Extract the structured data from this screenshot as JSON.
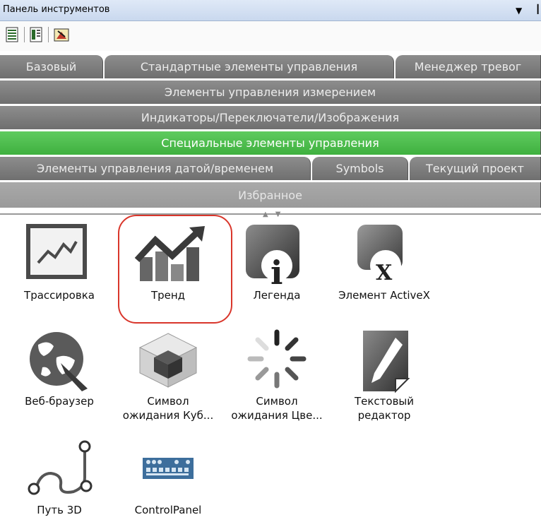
{
  "panel": {
    "title": "Панель инструментов",
    "pin_icon": "dropdown-arrow-icon",
    "extra_icon": "pin-icon"
  },
  "toolbar": {
    "icons": [
      "list-view-icon",
      "detail-view-icon",
      "picture-tool-icon"
    ]
  },
  "tabs": {
    "row1": [
      "Базовый",
      "Стандартные элементы управления",
      "Менеджер тревог"
    ],
    "row2": "Элементы управления измерением",
    "row3": "Индикаторы/Переключатели/Изображения",
    "row4_active": "Специальные элементы управления",
    "row5": [
      "Элементы управления датой/временем",
      "Symbols",
      "Текущий проект"
    ],
    "row6": "Избранное"
  },
  "items": [
    {
      "label": "Трассировка",
      "icon": "trace-chart-icon"
    },
    {
      "label": "Тренд",
      "icon": "trend-chart-icon"
    },
    {
      "label": "Легенда",
      "icon": "legend-info-icon"
    },
    {
      "label": "Элемент ActiveX",
      "icon": "activex-icon"
    },
    {
      "label": "Веб-браузер",
      "icon": "web-browser-globe-icon"
    },
    {
      "label": "Символ ожидания Куб...",
      "line1": "Символ",
      "line2": "ожидания Куб...",
      "icon": "waiting-cube-icon"
    },
    {
      "label": "Символ ожидания Цве...",
      "line1": "Символ",
      "line2": "ожидания Цве...",
      "icon": "waiting-spinner-icon"
    },
    {
      "label": "Текстовый редактор",
      "line1": "Текстовый",
      "line2": "редактор",
      "icon": "text-editor-icon"
    },
    {
      "label": "Путь 3D",
      "icon": "path-3d-icon"
    },
    {
      "label": "ControlPanel",
      "icon": "control-panel-icon"
    }
  ],
  "colors": {
    "tab_bg": "#7d7d7d",
    "tab_active": "#4cbc4c",
    "highlight_circle": "#d9362b"
  }
}
